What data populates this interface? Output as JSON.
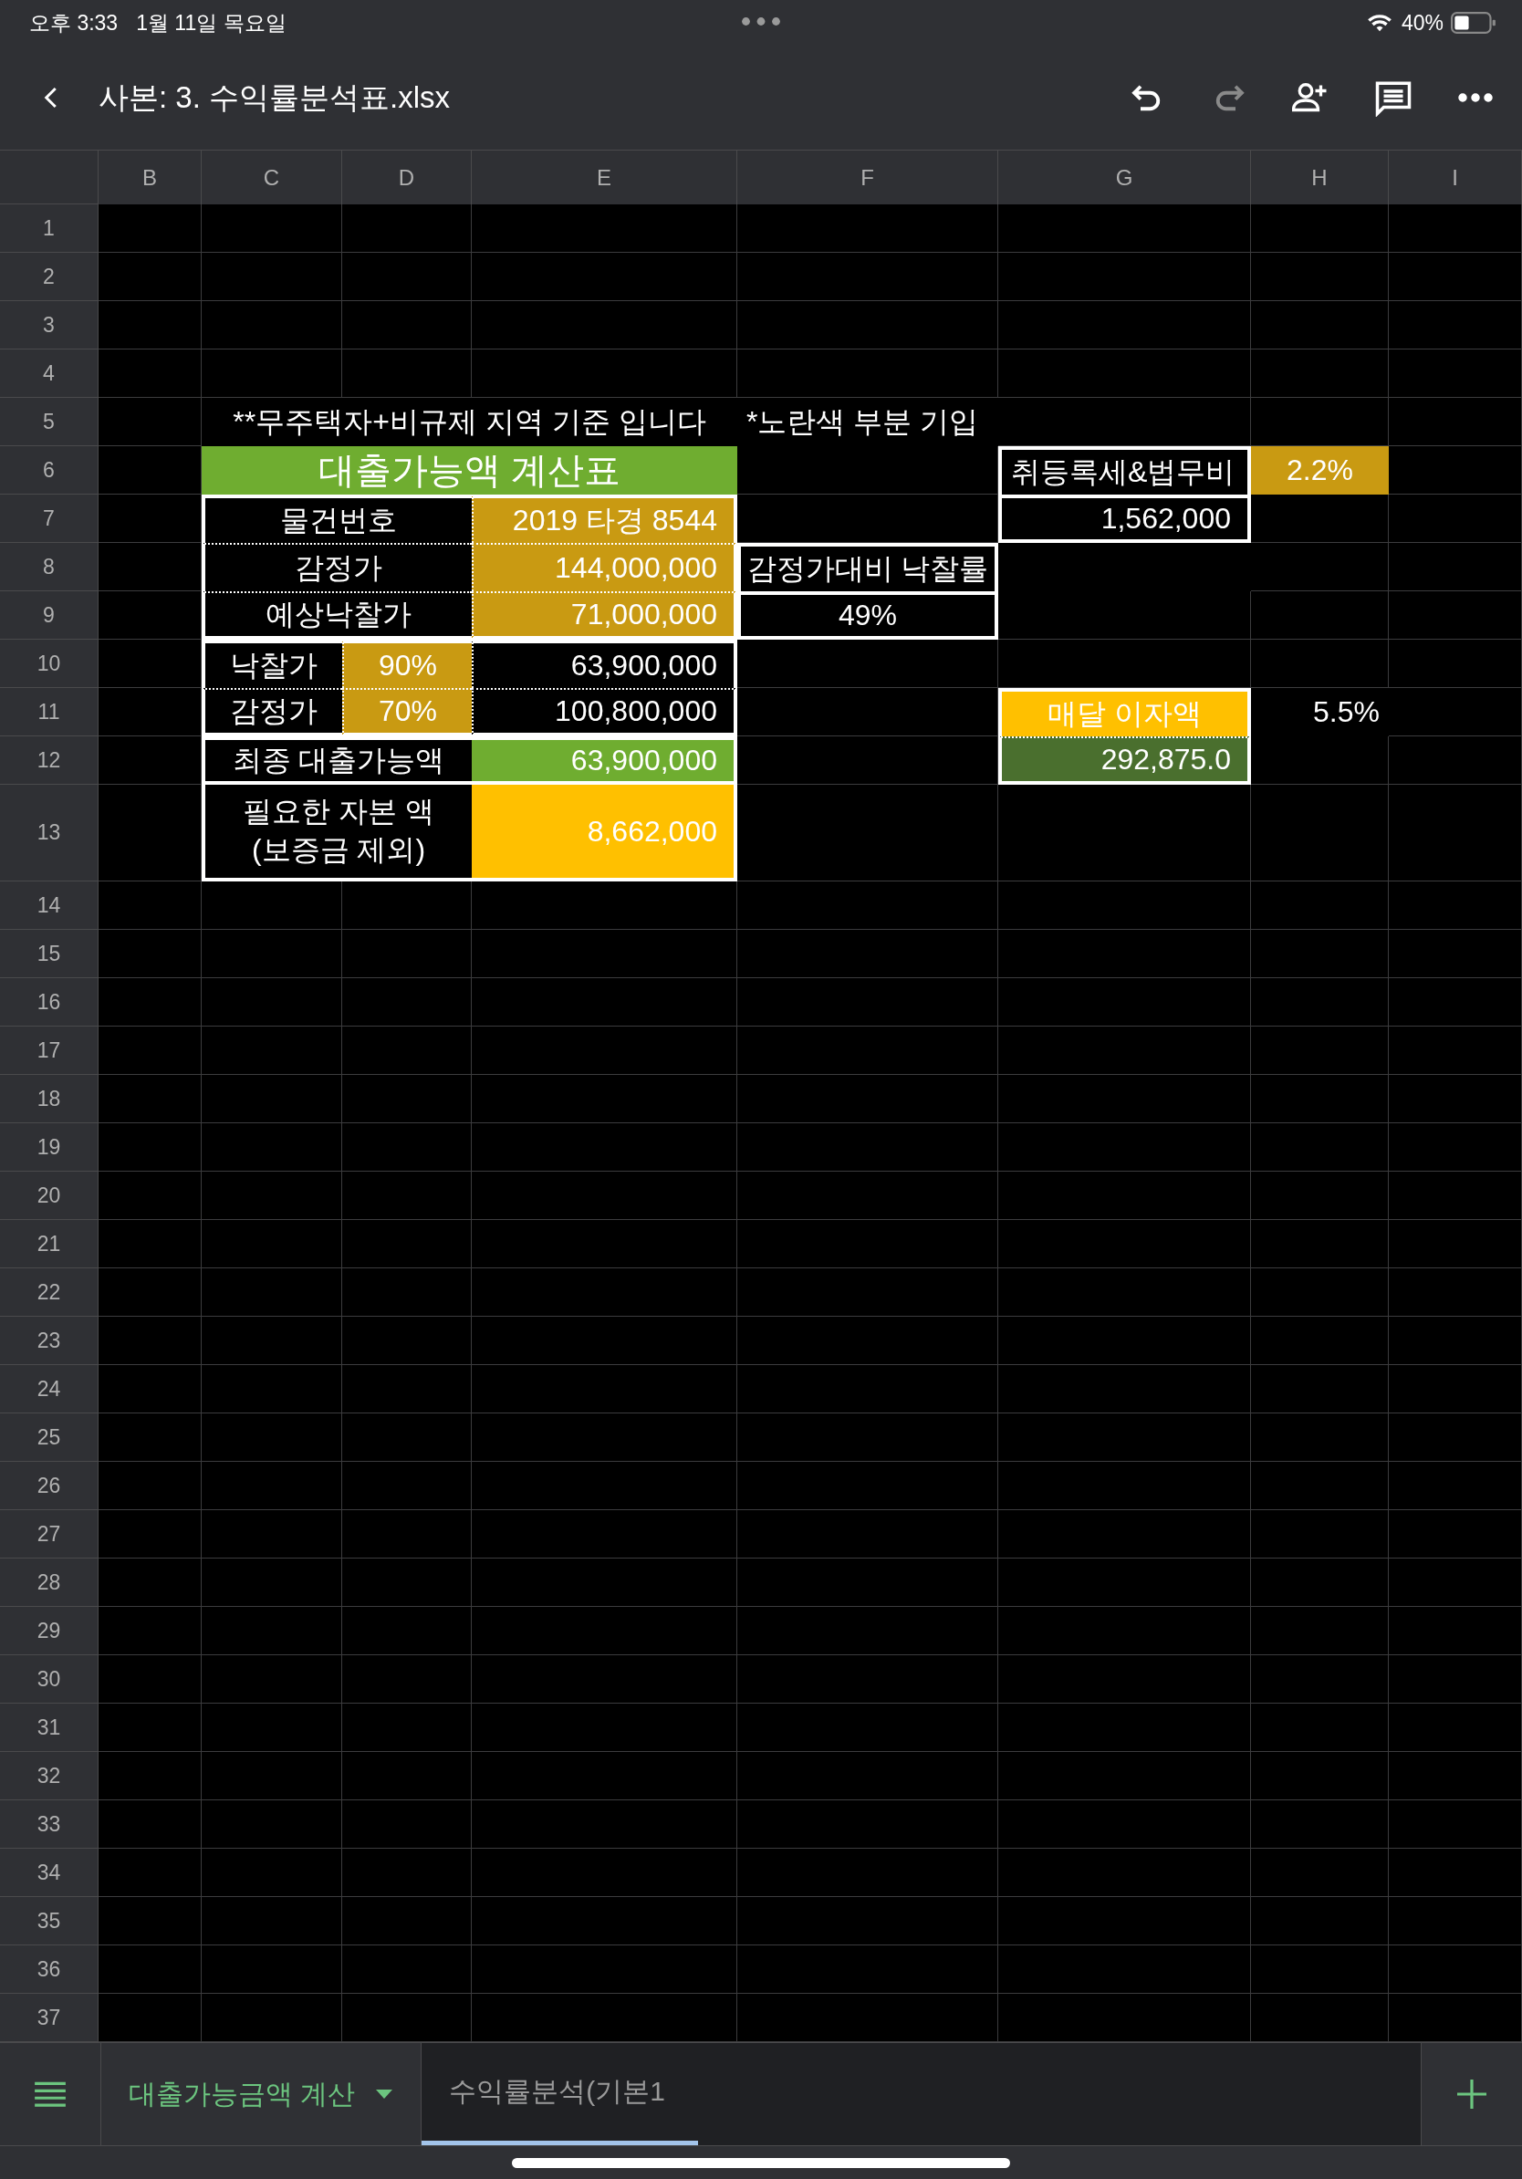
{
  "status_bar": {
    "time": "오후 3:33",
    "date": "1월 11일 목요일",
    "battery": "40%"
  },
  "toolbar": {
    "title": "사본: 3. 수익률분석표.xlsx",
    "redo_disabled": true
  },
  "columns": [
    "B",
    "C",
    "D",
    "E",
    "F",
    "G",
    "H",
    "I"
  ],
  "rows": [
    "1",
    "2",
    "3",
    "4",
    "5",
    "6",
    "7",
    "8",
    "9",
    "10",
    "11",
    "12",
    "13",
    "14",
    "15",
    "16",
    "17",
    "18",
    "19",
    "20",
    "21",
    "22",
    "23",
    "24",
    "25",
    "26",
    "27",
    "28",
    "29",
    "30",
    "31",
    "32",
    "33",
    "34",
    "35",
    "36",
    "37"
  ],
  "notes": [
    "**무주택자+비규제 지역 기준 입니다",
    "*노란색 부분 기입"
  ],
  "loan_table": {
    "title": "대출가능액 계산표",
    "item_number": {
      "label": "물건번호",
      "value": "2019 타경 8544"
    },
    "appraisal": {
      "label": "감정가",
      "value": "144,000,000"
    },
    "expected_bid": {
      "label": "예상낙찰가",
      "value": "71,000,000"
    },
    "bid_ratio": {
      "label": "낙찰가",
      "rate": "90%",
      "amount": "63,900,000"
    },
    "appraisal_ratio": {
      "label": "감정가",
      "rate": "70%",
      "amount": "100,800,000"
    },
    "final": {
      "label": "최종 대출가능액",
      "value": "63,900,000"
    },
    "capital": {
      "label_lines": [
        "필요한 자본 액",
        "(보증금 제외)"
      ],
      "value": "8,662,000"
    }
  },
  "bid_rate": {
    "label": "감정가대비 낙찰률",
    "value": "49%"
  },
  "fees": {
    "label": "취등록세&법무비",
    "rate": "2.2%",
    "amount": "1,562,000"
  },
  "interest": {
    "label": "매달 이자액",
    "rate": "5.5%",
    "amount": "292,875.0"
  },
  "sheet_tabs": [
    {
      "label": "대출가능금액 계산",
      "selected": true
    },
    {
      "label": "수익률분석(기본1",
      "selected": false
    }
  ]
}
